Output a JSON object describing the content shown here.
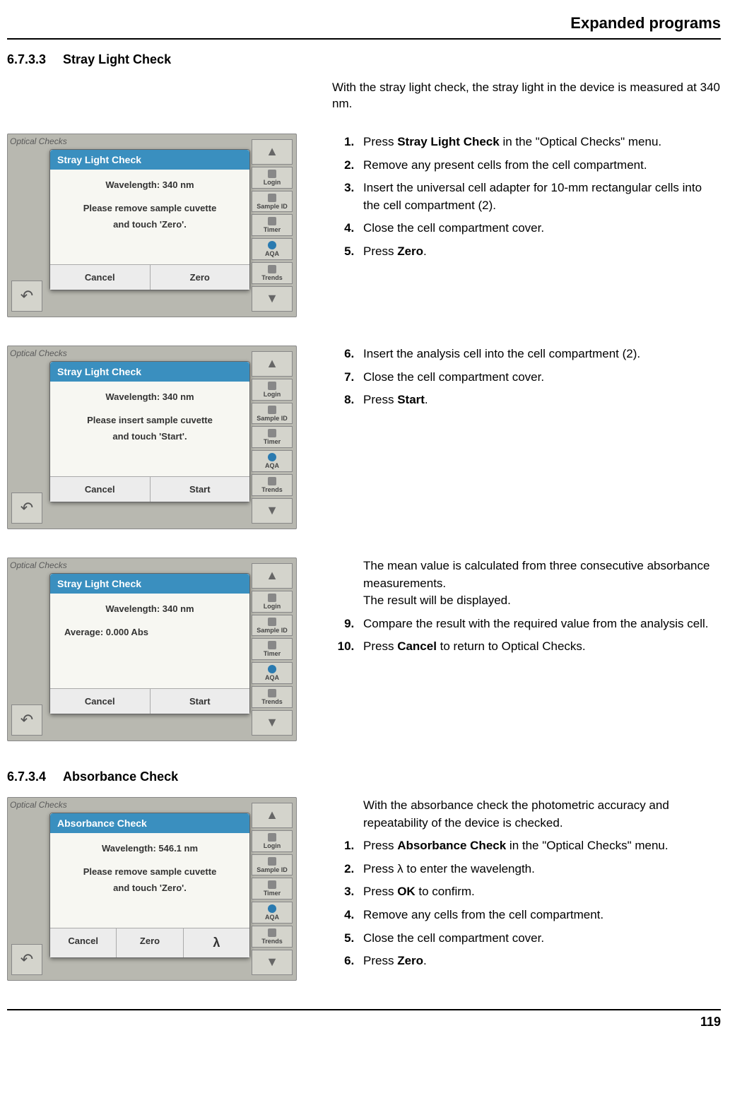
{
  "header": "Expanded programs",
  "section1": {
    "number": "6.7.3.3",
    "title": "Stray Light Check",
    "intro": "With the stray light check, the stray light in the device is measured at 340 nm."
  },
  "sidebar": {
    "titlebar": "Optical Checks",
    "login": "Login",
    "sampleid": "Sample ID",
    "timer": "Timer",
    "aqa": "AQA",
    "trends": "Trends"
  },
  "shot1": {
    "title": "Stray Light Check",
    "wavelength": "Wavelength: 340 nm",
    "msg1": "Please remove sample cuvette",
    "msg2": "and touch 'Zero'.",
    "btn1": "Cancel",
    "btn2": "Zero"
  },
  "steps1": [
    {
      "pre": "Press ",
      "bold": "Stray Light Check",
      "post": " in the \"Optical Checks\" menu."
    },
    {
      "pre": "Remove any present cells from the cell compartment.",
      "bold": "",
      "post": ""
    },
    {
      "pre": "Insert the universal cell adapter for 10-mm rectangular cells into the cell compartment (2).",
      "bold": "",
      "post": ""
    },
    {
      "pre": "Close the cell compartment cover.",
      "bold": "",
      "post": ""
    },
    {
      "pre": "Press ",
      "bold": "Zero",
      "post": "."
    }
  ],
  "shot2": {
    "title": "Stray Light Check",
    "wavelength": "Wavelength: 340 nm",
    "msg1": "Please insert sample cuvette",
    "msg2": "and touch 'Start'.",
    "btn1": "Cancel",
    "btn2": "Start"
  },
  "steps2_start": 6,
  "steps2": [
    {
      "pre": "Insert the analysis cell into the cell compartment (2).",
      "bold": "",
      "post": ""
    },
    {
      "pre": "Close the cell compartment cover.",
      "bold": "",
      "post": ""
    },
    {
      "pre": "Press ",
      "bold": "Start",
      "post": "."
    }
  ],
  "shot3": {
    "title": "Stray Light Check",
    "wavelength": "Wavelength: 340 nm",
    "avg": "Average:  0.000 Abs",
    "btn1": "Cancel",
    "btn2": "Start"
  },
  "steps3_intro1": "The mean value is calculated from three consecutive absorbance measurements.",
  "steps3_intro2": "The result will be displayed.",
  "steps3_start": 9,
  "steps3": [
    {
      "pre": "Compare the result with the required value from the analysis cell.",
      "bold": "",
      "post": ""
    },
    {
      "pre": "Press ",
      "bold": "Cancel",
      "post": " to return to Optical Checks."
    }
  ],
  "section2": {
    "number": "6.7.3.4",
    "title": "Absorbance Check"
  },
  "shot4": {
    "title": "Absorbance Check",
    "wavelength": "Wavelength: 546.1 nm",
    "msg1": "Please remove sample cuvette",
    "msg2": "and touch 'Zero'.",
    "btn1": "Cancel",
    "btn2": "Zero",
    "btn3": "λ"
  },
  "steps4_intro": "With the absorbance check the photometric accuracy and repeatability of the device is checked.",
  "steps4": [
    {
      "pre": "Press ",
      "bold": "Absorbance Check",
      "post": " in the \"Optical Checks\" menu."
    },
    {
      "pre": "Press λ to enter the wavelength.",
      "bold": "",
      "post": ""
    },
    {
      "pre": "Press ",
      "bold": "OK",
      "post": " to confirm."
    },
    {
      "pre": "Remove any cells from the cell compartment.",
      "bold": "",
      "post": ""
    },
    {
      "pre": "Close the cell compartment cover.",
      "bold": "",
      "post": ""
    },
    {
      "pre": "Press ",
      "bold": "Zero",
      "post": "."
    }
  ],
  "page_number": "119"
}
